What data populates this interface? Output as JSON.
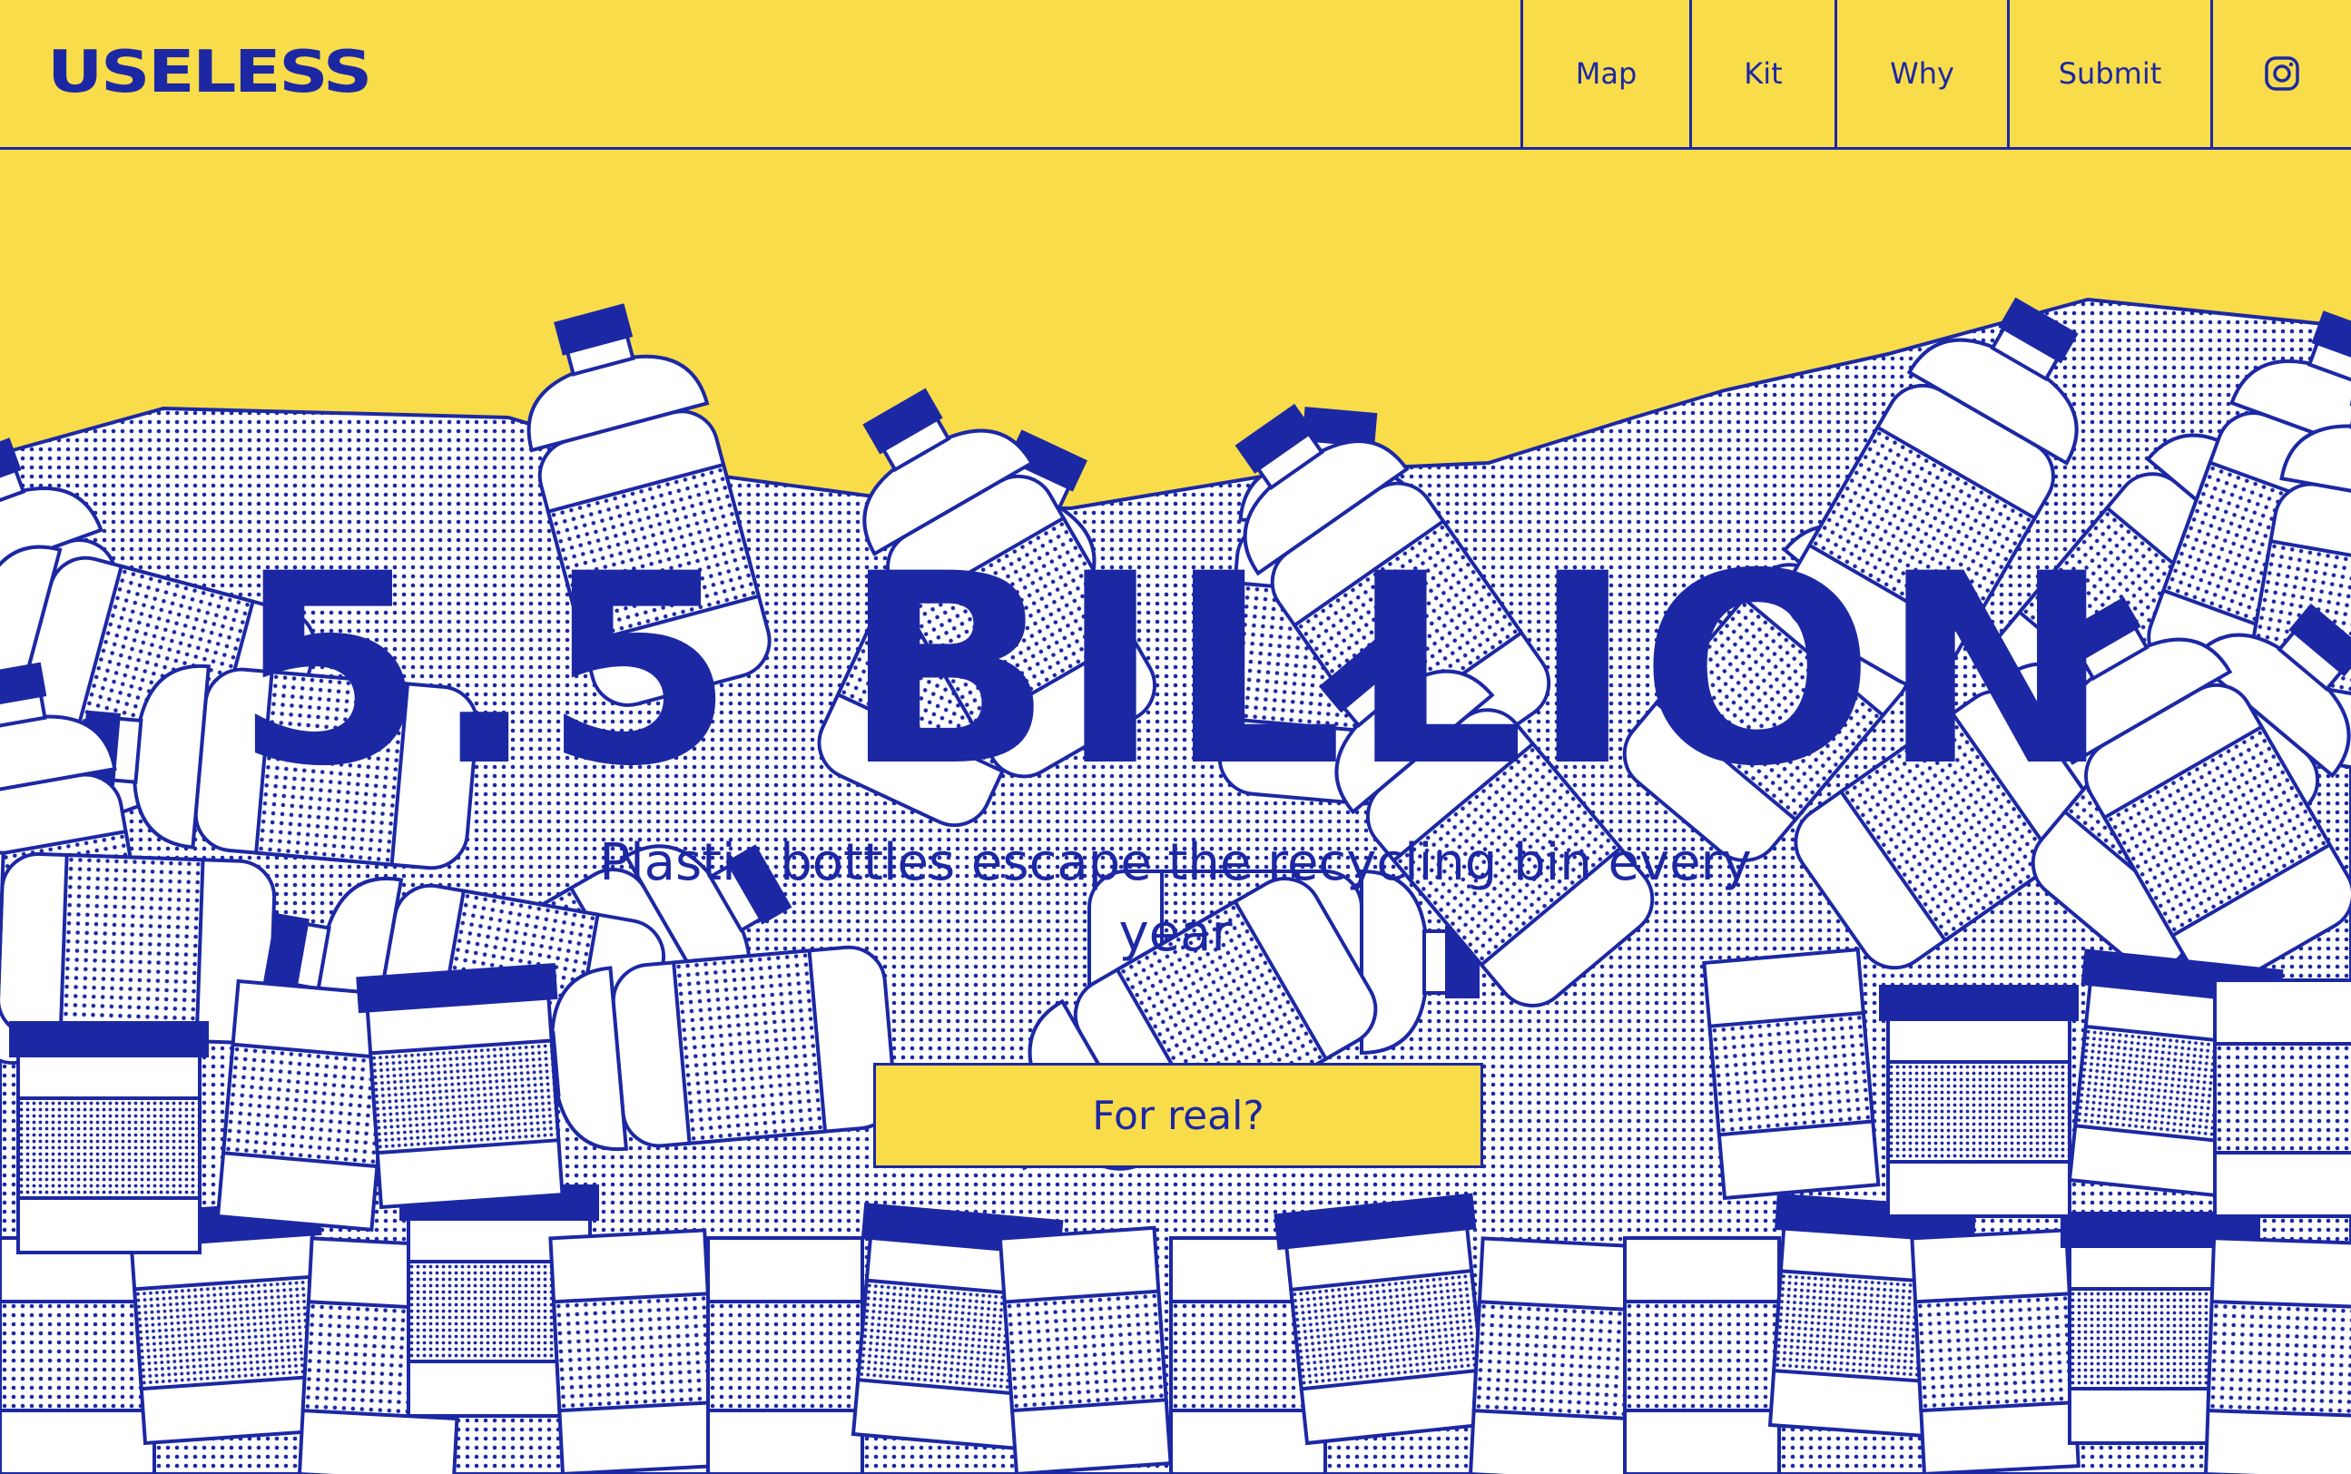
{
  "header": {
    "logo": "USELESS",
    "nav": [
      {
        "label": "Map"
      },
      {
        "label": "Kit"
      },
      {
        "label": "Why"
      },
      {
        "label": "Submit"
      }
    ],
    "social_icon": "instagram-icon"
  },
  "hero": {
    "headline": "5.5 BILLION",
    "subtitle": "Plastic bottles escape the recycling bin every year",
    "cta_label": "For real?"
  },
  "colors": {
    "background": "#F9DC4A",
    "accent": "#1C28A3",
    "white": "#FFFFFF"
  }
}
